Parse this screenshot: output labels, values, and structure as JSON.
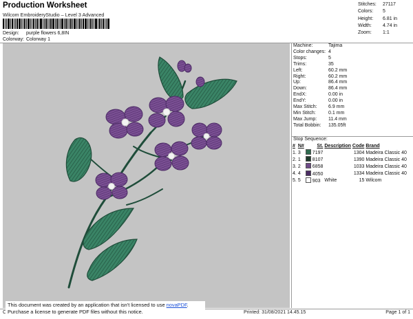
{
  "header": {
    "title": "Production Worksheet",
    "subtitle": "Wilcom EmbroideryStudio – Level 3 Advanced",
    "design_label": "Design:",
    "design_value": "purple flowers 6,8IN",
    "colorway_label": "Colorway:",
    "colorway_value": "Colorway 1"
  },
  "stats": [
    {
      "label": "Stitches:",
      "value": "27117"
    },
    {
      "label": "Colors:",
      "value": "5"
    },
    {
      "label": "Height:",
      "value": "6.81 in"
    },
    {
      "label": "Width:",
      "value": "4.74 in"
    },
    {
      "label": "Zoom:",
      "value": "1:1"
    }
  ],
  "details": [
    {
      "label": "Machine:",
      "value": "Tajima"
    },
    {
      "label": "Color changes:",
      "value": "4"
    },
    {
      "label": "Stops:",
      "value": "5"
    },
    {
      "label": "Trims:",
      "value": "35"
    },
    {
      "label": "Left:",
      "value": "60.2 mm"
    },
    {
      "label": "Right:",
      "value": "60.2 mm"
    },
    {
      "label": "Up:",
      "value": "86.4 mm"
    },
    {
      "label": "Down:",
      "value": "86.4 mm"
    },
    {
      "label": "EndX:",
      "value": "0.00 in"
    },
    {
      "label": "EndY:",
      "value": "0.00 in"
    },
    {
      "label": "Max Stitch:",
      "value": "6.9 mm"
    },
    {
      "label": "Min Stitch:",
      "value": "0.1 mm"
    },
    {
      "label": "Max Jump:",
      "value": "11.4 mm"
    },
    {
      "label": "Total Bobbin:",
      "value": "135.05ft"
    }
  ],
  "stop_sequence": {
    "title": "Stop Sequence:",
    "columns": [
      "#",
      "N#",
      "St.",
      "Description",
      "Code",
      "Brand"
    ],
    "rows": [
      {
        "idx": "1.",
        "n": "3",
        "swatch": "#2f6b4f",
        "st": "7197",
        "desc": "",
        "code": "1304",
        "brand": "Madeira Classic 40"
      },
      {
        "idx": "2.",
        "n": "1",
        "swatch": "#1f3a2c",
        "st": "8107",
        "desc": "",
        "code": "1390",
        "brand": "Madeira Classic 40"
      },
      {
        "idx": "3.",
        "n": "2",
        "swatch": "#6e4a88",
        "st": "6858",
        "desc": "",
        "code": "1033",
        "brand": "Madeira Classic 40"
      },
      {
        "idx": "4.",
        "n": "4",
        "swatch": "#4a2c63",
        "st": "4050",
        "desc": "",
        "code": "1334",
        "brand": "Madeira Classic 40"
      },
      {
        "idx": "5.",
        "n": "5",
        "swatch": "#ffffff",
        "st": "903",
        "desc": "White",
        "code": "15",
        "brand": "Wilcom"
      }
    ]
  },
  "notice": {
    "line1_prefix": "This document was created by an application that isn't licensed to use ",
    "link": "novaPDF",
    "line1_suffix": ".",
    "line2": "Purchase a license to generate PDF files without this notice."
  },
  "footer": {
    "left": "Cr",
    "printed": "Printed: 31/08/2021 14.45.15",
    "page": "Page 1 of 1"
  },
  "colors": {
    "leaf": "#3a8466",
    "leaf_dark": "#1f4d3a",
    "petal": "#7a4f93",
    "petal_dark": "#4d2c66",
    "canvas": "#c4c4c4"
  }
}
